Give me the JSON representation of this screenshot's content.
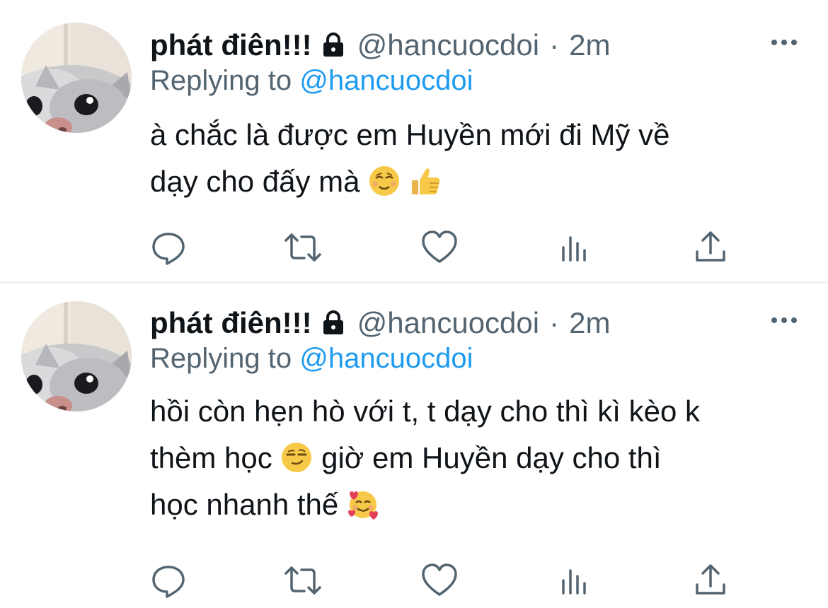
{
  "tweets": [
    {
      "name": "phát điên!!!",
      "handle": "@hancuocdoi",
      "separator": "·",
      "time": "2m",
      "replying_prefix": "Replying to",
      "replying_to": "@hancuocdoi",
      "lines": [
        {
          "text": "à chắc là được em Huyền mới đi Mỹ về",
          "emojis": []
        },
        {
          "text": "dạy cho đấy mà",
          "emojis": [
            "relieved-face-emoji",
            "thumbs-up-emoji"
          ]
        }
      ]
    },
    {
      "name": "phát điên!!!",
      "handle": "@hancuocdoi",
      "separator": "·",
      "time": "2m",
      "replying_prefix": "Replying to",
      "replying_to": "@hancuocdoi",
      "lines": [
        {
          "text": "hồi còn hẹn hò với t, t dạy cho thì kì kèo k",
          "emojis": []
        },
        {
          "text_before": "thèm học",
          "emoji": "smirking-face-emoji",
          "text_after": "giờ em Huyền dạy cho thì"
        },
        {
          "text": "học nhanh thế",
          "emojis": [
            "smiling-face-with-hearts-emoji"
          ]
        }
      ]
    }
  ],
  "icons": {
    "lock": "lock-icon",
    "more": "more-options-icon",
    "reply": "reply-icon",
    "retweet": "retweet-icon",
    "like": "heart-icon",
    "views": "analytics-icon",
    "share": "share-icon"
  },
  "colors": {
    "text_primary": "#0f1419",
    "text_secondary": "#536471",
    "link": "#1d9bf0",
    "divider": "#eff3f4"
  }
}
